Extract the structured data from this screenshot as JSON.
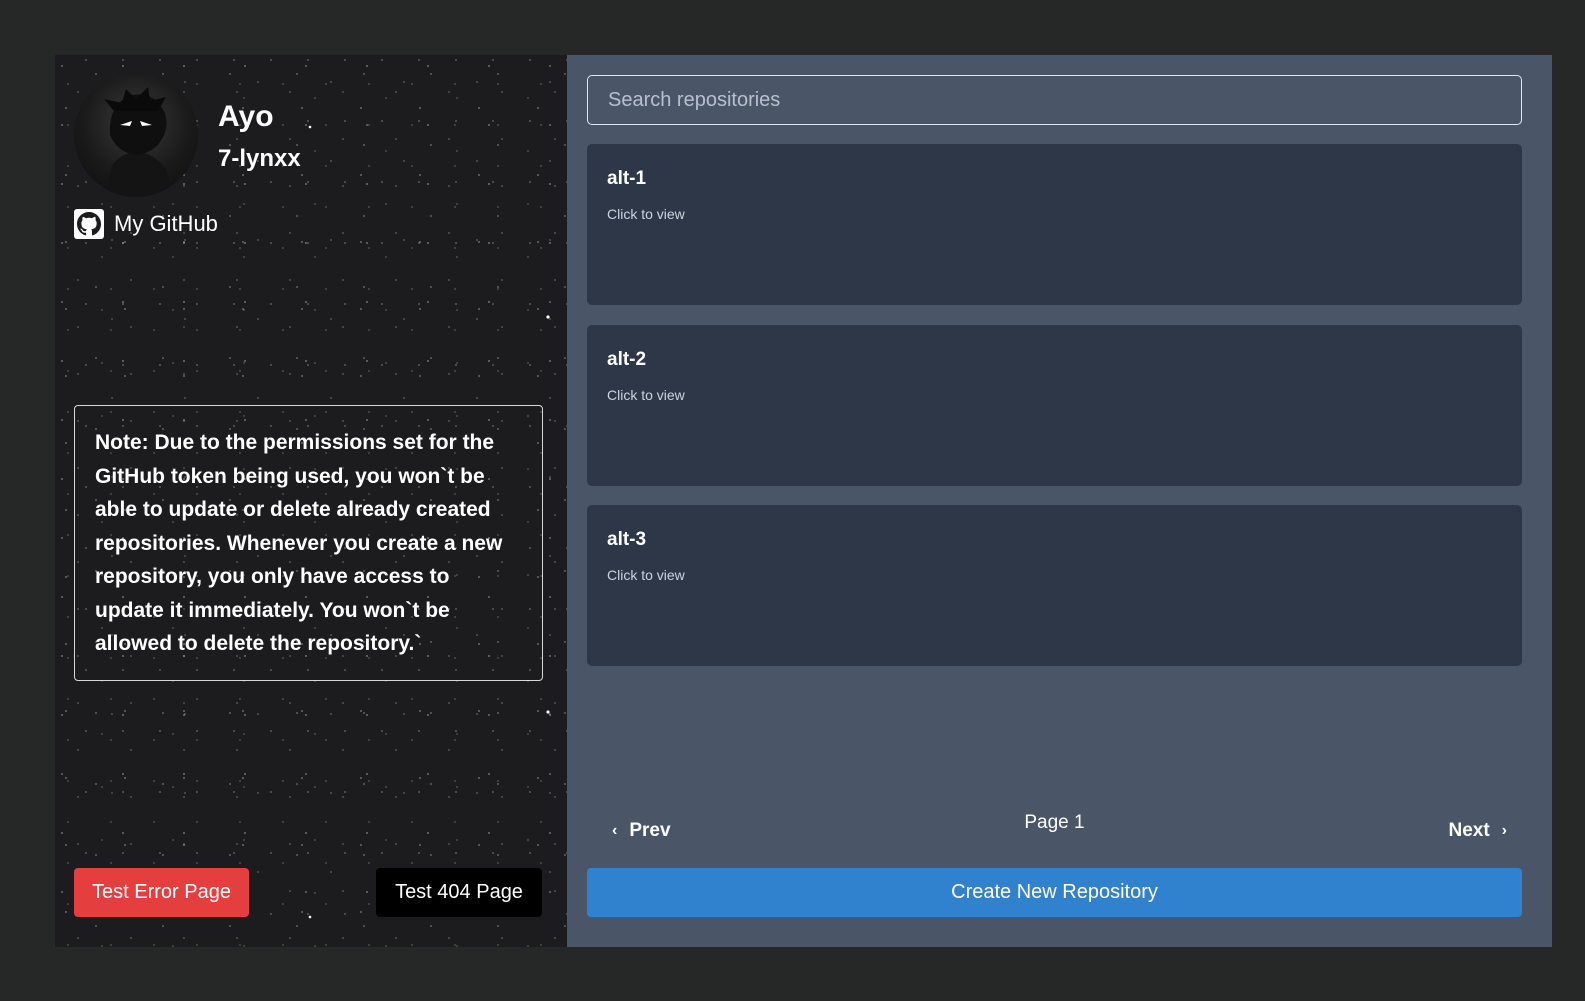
{
  "profile": {
    "name": "Ayo",
    "username": "7-lynxx",
    "github_link_label": "My GitHub"
  },
  "note": {
    "label": "Note:",
    "text": " Due to the permissions set for the GitHub token being used, you won`t be able to update or delete already created repositories. Whenever you create a new repository, you only have access to update it immediately. You won`t be allowed to delete the repository.`"
  },
  "buttons": {
    "test_error": "Test Error Page",
    "test_404": "Test 404 Page",
    "create_repo": "Create New Repository"
  },
  "search": {
    "placeholder": "Search repositories",
    "value": ""
  },
  "repos": [
    {
      "name": "alt-1",
      "subtitle": "Click to view"
    },
    {
      "name": "alt-2",
      "subtitle": "Click to view"
    },
    {
      "name": "alt-3",
      "subtitle": "Click to view"
    }
  ],
  "pagination": {
    "prev_label": "Prev",
    "next_label": "Next",
    "page_label": "Page 1"
  },
  "colors": {
    "background": "#262828",
    "right_panel": "#4a5568",
    "card": "#2d3748",
    "error_button": "#e53e3e",
    "primary_button": "#3182ce",
    "dark_button": "#000000"
  },
  "icons": {
    "github": "github-icon",
    "prev": "chevron-left-icon",
    "next": "chevron-right-icon"
  }
}
